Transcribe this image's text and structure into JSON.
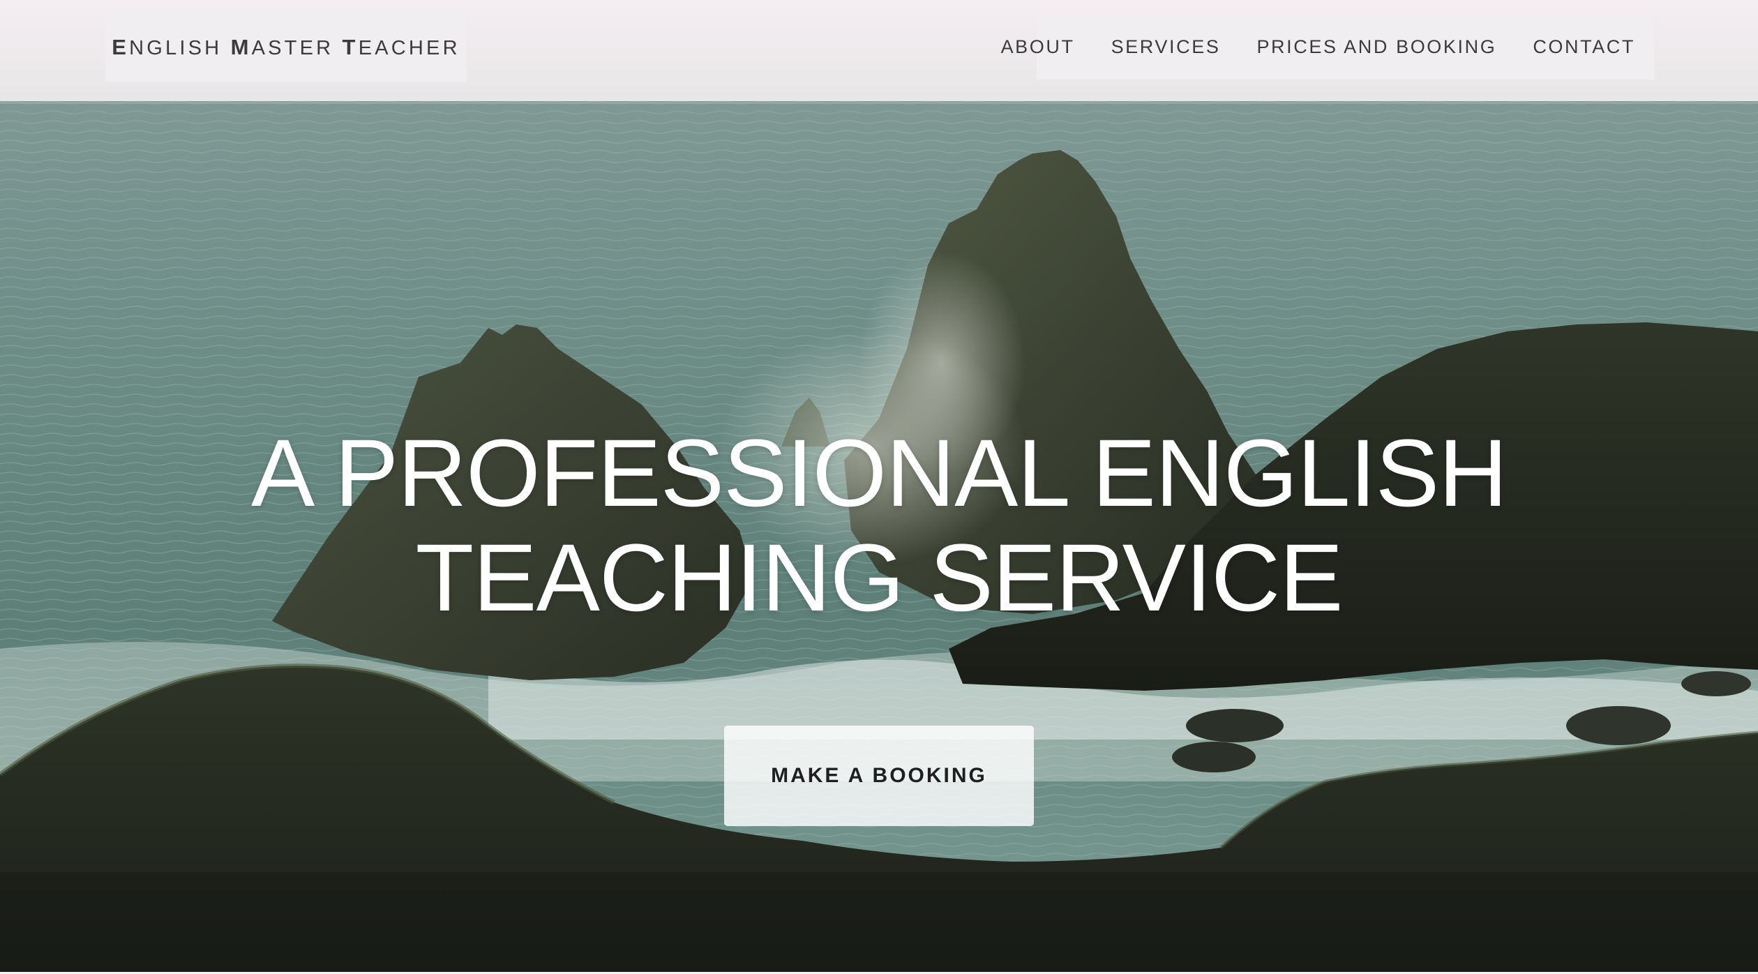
{
  "header": {
    "logo": {
      "words": [
        {
          "cap": "E",
          "rest": "NGLISH"
        },
        {
          "cap": "M",
          "rest": "ASTER"
        },
        {
          "cap": "T",
          "rest": "EACHER"
        }
      ]
    },
    "nav": [
      {
        "label": "ABOUT"
      },
      {
        "label": "SERVICES"
      },
      {
        "label": "PRICES AND BOOKING"
      },
      {
        "label": "CONTACT"
      }
    ]
  },
  "hero": {
    "title_line_1": "A PROFESSIONAL ENGLISH",
    "title_line_2": "TEACHING SERVICE",
    "cta_label": "MAKE A BOOKING",
    "background": "coastal-sea-stacks-photo"
  },
  "colors": {
    "header_bg": "#f0eef0",
    "header_text": "#3b3b3d",
    "title_text": "#ffffff",
    "cta_bg": "#ffffff",
    "cta_text": "#1f1f22"
  }
}
